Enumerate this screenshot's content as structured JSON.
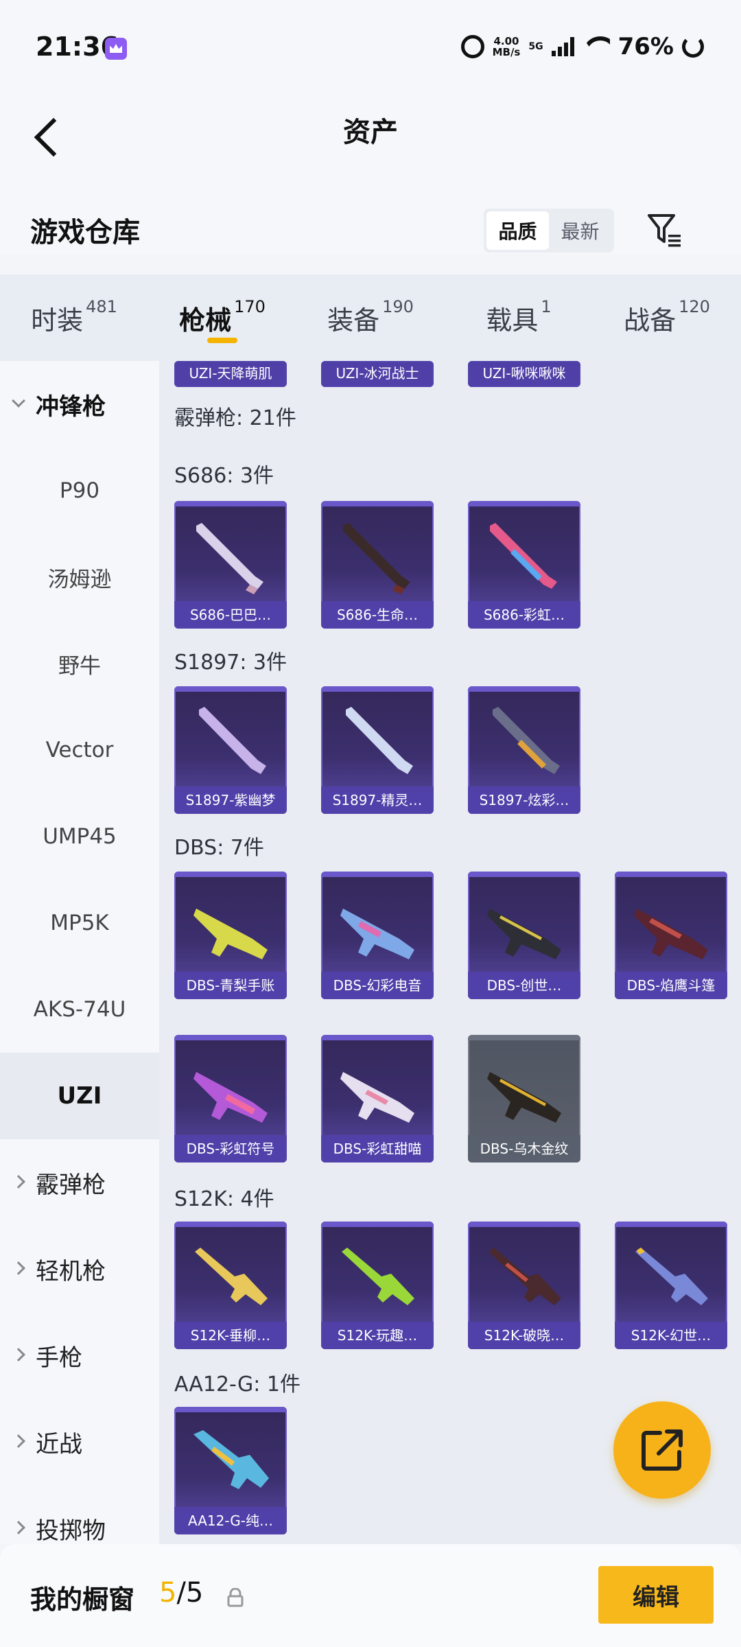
{
  "status_bar": {
    "time": "21:36",
    "net_speed_value": "4.00",
    "net_speed_unit": "MB/s",
    "network": "5G",
    "battery": "76%"
  },
  "header": {
    "title": "资产",
    "section_title": "游戏仓库",
    "sort_options": [
      "品质",
      "最新"
    ],
    "sort_selected": "品质"
  },
  "tabs": [
    {
      "label": "时装",
      "count": "481"
    },
    {
      "label": "枪械",
      "count": "170",
      "active": true
    },
    {
      "label": "装备",
      "count": "190"
    },
    {
      "label": "载具",
      "count": "1"
    },
    {
      "label": "战备",
      "count": "120"
    }
  ],
  "sidebar": {
    "open_category": "冲锋枪",
    "subcategories": [
      "P90",
      "汤姆逊",
      "野牛",
      "Vector",
      "UMP45",
      "MP5K",
      "AKS-74U",
      "UZI"
    ],
    "selected_sub": "UZI",
    "other_categories": [
      "霰弹枪",
      "轻机枪",
      "手枪",
      "近战",
      "投掷物"
    ]
  },
  "content": {
    "top_cut_items": [
      "UZI-天降萌肌",
      "UZI-冰河战士",
      "UZI-啾咪啾咪"
    ],
    "category_header": "霰弹枪: 21件",
    "groups": [
      {
        "label": "S686: 3件",
        "items": [
          "S686-巴巴…",
          "S686-生命…",
          "S686-彩虹…"
        ]
      },
      {
        "label": "S1897: 3件",
        "items": [
          "S1897-紫幽梦",
          "S1897-精灵…",
          "S1897-炫彩…"
        ]
      },
      {
        "label": "DBS: 7件",
        "items": [
          "DBS-青梨手账",
          "DBS-幻彩电音",
          "DBS-创世…",
          "DBS-焰鹰斗篷",
          "DBS-彩虹符号",
          "DBS-彩虹甜喵",
          "DBS-乌木金纹"
        ]
      },
      {
        "label": "S12K: 4件",
        "items": [
          "S12K-垂柳…",
          "S12K-玩趣…",
          "S12K-破晓…",
          "S12K-幻世…"
        ]
      },
      {
        "label": "AA12-G: 1件",
        "items": [
          "AA12-G-纯…"
        ]
      }
    ]
  },
  "bottom_bar": {
    "title": "我的橱窗",
    "count_current": "5",
    "count_total": "/5",
    "edit_label": "编辑"
  },
  "colors": {
    "accent": "#f7b81b",
    "card_purple": "#3c2f6e",
    "card_label": "#5040aa"
  }
}
